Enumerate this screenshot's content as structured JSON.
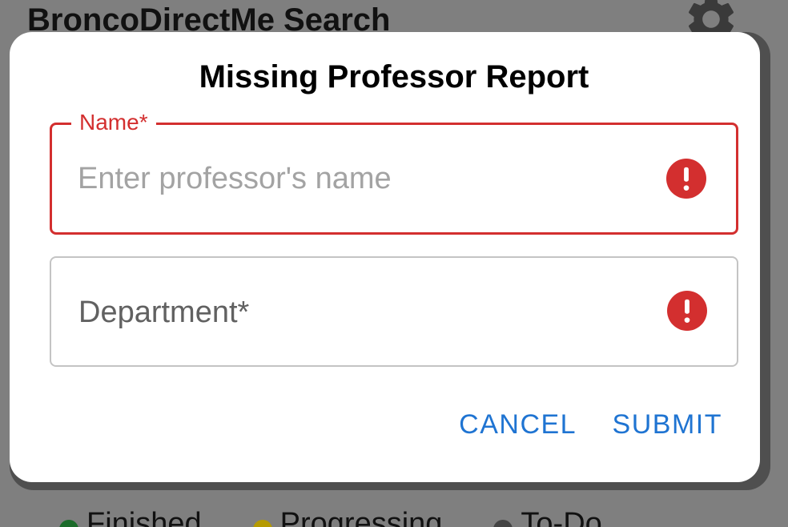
{
  "background": {
    "app_title": "BroncoDirectMe Search",
    "settings_icon": "gear-icon",
    "legend": [
      {
        "label": "Finished",
        "color": "#1b6b2a"
      },
      {
        "label": "Progressing",
        "color": "#b59a00"
      },
      {
        "label": "To-Do",
        "color": "#444444"
      }
    ]
  },
  "dialog": {
    "title": "Missing Professor Report",
    "fields": {
      "name": {
        "label": "Name*",
        "value": "",
        "placeholder": "Enter professor's name",
        "state": "error",
        "icon": "error-icon"
      },
      "department": {
        "label": "Department*",
        "value": "",
        "state": "error",
        "icon": "error-icon"
      }
    },
    "actions": {
      "cancel_label": "CANCEL",
      "submit_label": "SUBMIT"
    }
  },
  "colors": {
    "error": "#d32f2f",
    "accent": "#1f74d2",
    "overlay": "#7f7f7f"
  }
}
